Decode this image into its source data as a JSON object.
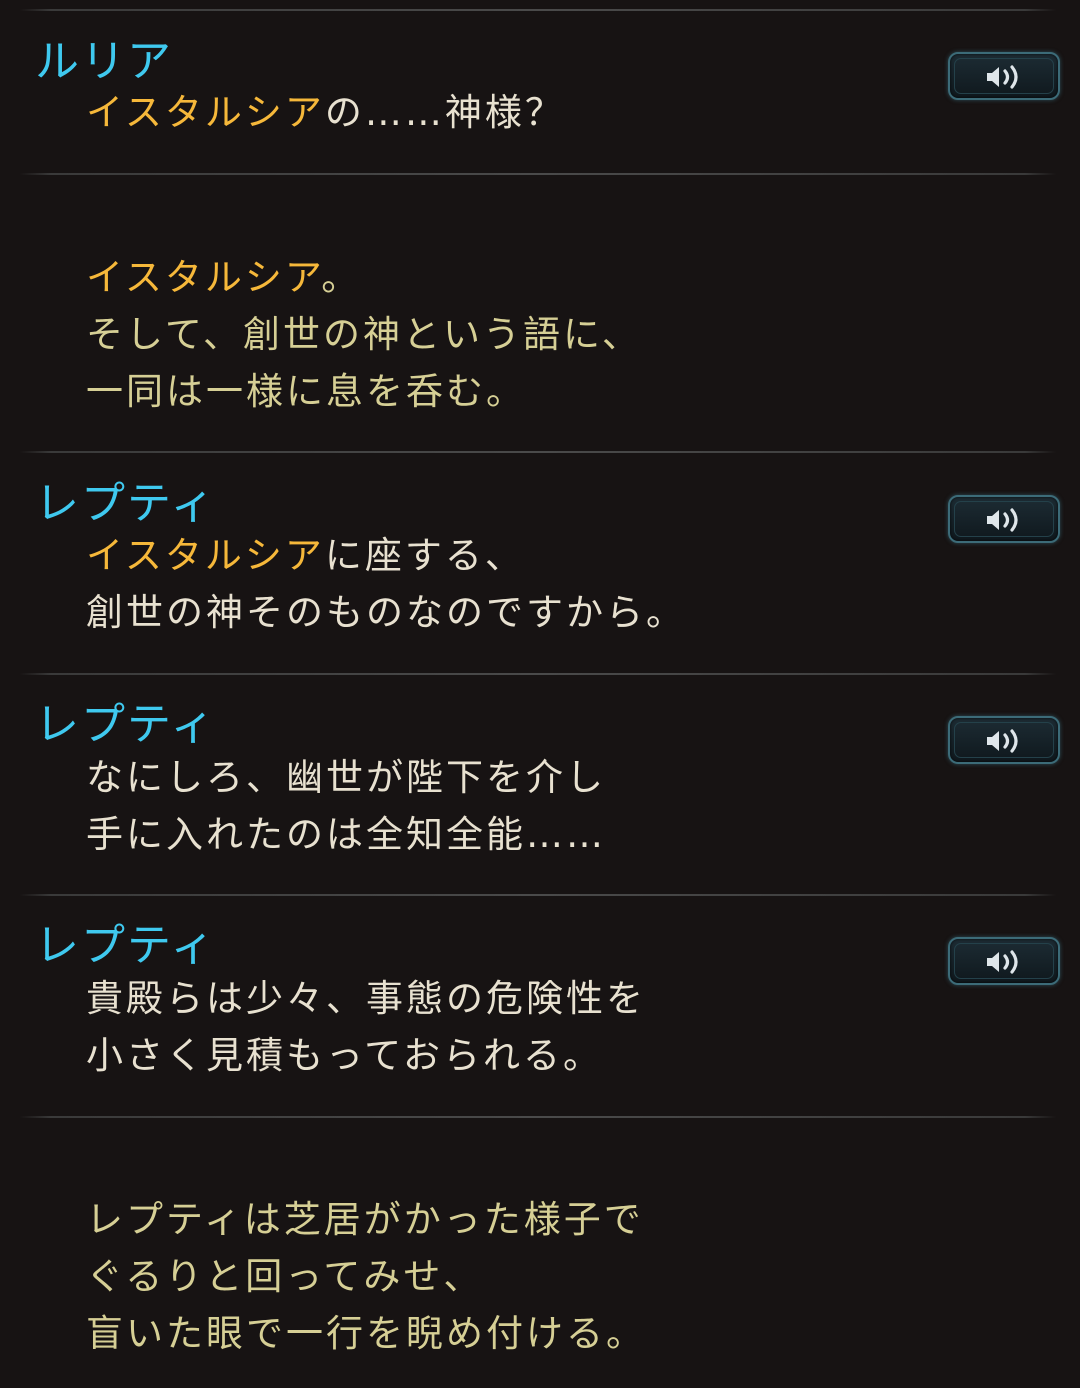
{
  "entries": [
    {
      "speaker": "ルリア",
      "lines": [
        {
          "hl": "イスタルシア",
          "rest": "の……神様？"
        }
      ],
      "voice_icon": "speaker-sound-icon"
    },
    {
      "speaker": "",
      "lines": [
        {
          "hl": "イスタルシア",
          "rest": "。"
        },
        {
          "hl": "",
          "rest": "そして、創世の神という語に、"
        },
        {
          "hl": "",
          "rest": "一同は一様に息を呑む。"
        }
      ]
    },
    {
      "speaker": "レプティ",
      "lines": [
        {
          "hl": "イスタルシア",
          "rest": "に座する、"
        },
        {
          "hl": "",
          "rest": "創世の神そのものなのですから。"
        }
      ],
      "voice_icon": "speaker-sound-icon"
    },
    {
      "speaker": "レプティ",
      "lines": [
        {
          "hl": "",
          "rest": "なにしろ、幽世が陛下を介し"
        },
        {
          "hl": "",
          "rest": "手に入れたのは全知全能……"
        }
      ],
      "voice_icon": "speaker-sound-icon"
    },
    {
      "speaker": "レプティ",
      "lines": [
        {
          "hl": "",
          "rest": "貴殿らは少々、事態の危険性を"
        },
        {
          "hl": "",
          "rest": "小さく見積もっておられる。"
        }
      ],
      "voice_icon": "speaker-sound-icon"
    },
    {
      "speaker": "",
      "lines": [
        {
          "hl": "",
          "rest": "レプティは芝居がかった様子で"
        },
        {
          "hl": "",
          "rest": "ぐるりと回ってみせ、"
        },
        {
          "hl": "",
          "rest": "盲いた眼で一行を睨め付ける。"
        }
      ]
    }
  ],
  "colors": {
    "background": "#171313",
    "speaker": "#3fc9ef",
    "highlight": "#f6b83a",
    "dialogue": "#e8e1d0",
    "narration": "#d6cf95"
  }
}
